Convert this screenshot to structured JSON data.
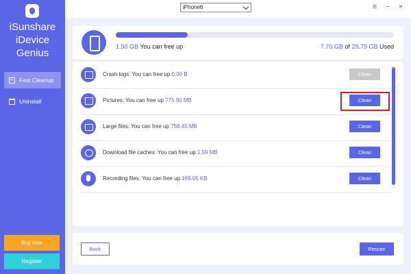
{
  "app": {
    "brand_lines": [
      "iSunshare",
      "iDevice",
      "Genius"
    ]
  },
  "sidebar": {
    "items": [
      {
        "label": "Fast Cleanup",
        "icon": "broom-icon",
        "active": true
      },
      {
        "label": "Uninstall",
        "icon": "trash-icon",
        "active": false
      }
    ],
    "buy_label": "Buy now",
    "register_label": "Register"
  },
  "titlebar": {
    "device": "iPhone6"
  },
  "storage": {
    "free_amount": "1.50 GB",
    "free_suffix": "You can free up",
    "used_amount": "7.70 GB",
    "of_word": "of",
    "total_amount": "29.79 GB",
    "used_suffix": "Used",
    "used_fraction": 0.26
  },
  "items": [
    {
      "prefix": "Crash logs: You can free up",
      "amount": "0.00 B",
      "button": "Clean",
      "enabled": false
    },
    {
      "prefix": "Pictures: You can free up",
      "amount": "775.90 MB",
      "button": "Clean",
      "enabled": true
    },
    {
      "prefix": "Large files: You can free up",
      "amount": "758.45 MB",
      "button": "Clean",
      "enabled": true
    },
    {
      "prefix": "Download file caches: You can free up",
      "amount": "1.59 MB",
      "button": "Clean",
      "enabled": true
    },
    {
      "prefix": "Recording files: You can free up",
      "amount": "169.05 KB",
      "button": "Clean",
      "enabled": true
    }
  ],
  "footer": {
    "back_label": "Back",
    "rescan_label": "Rescan"
  },
  "colors": {
    "accent": "#5b66e6",
    "buy": "#f6a623",
    "register": "#2fd0d8",
    "highlight": "#d81e1e"
  }
}
